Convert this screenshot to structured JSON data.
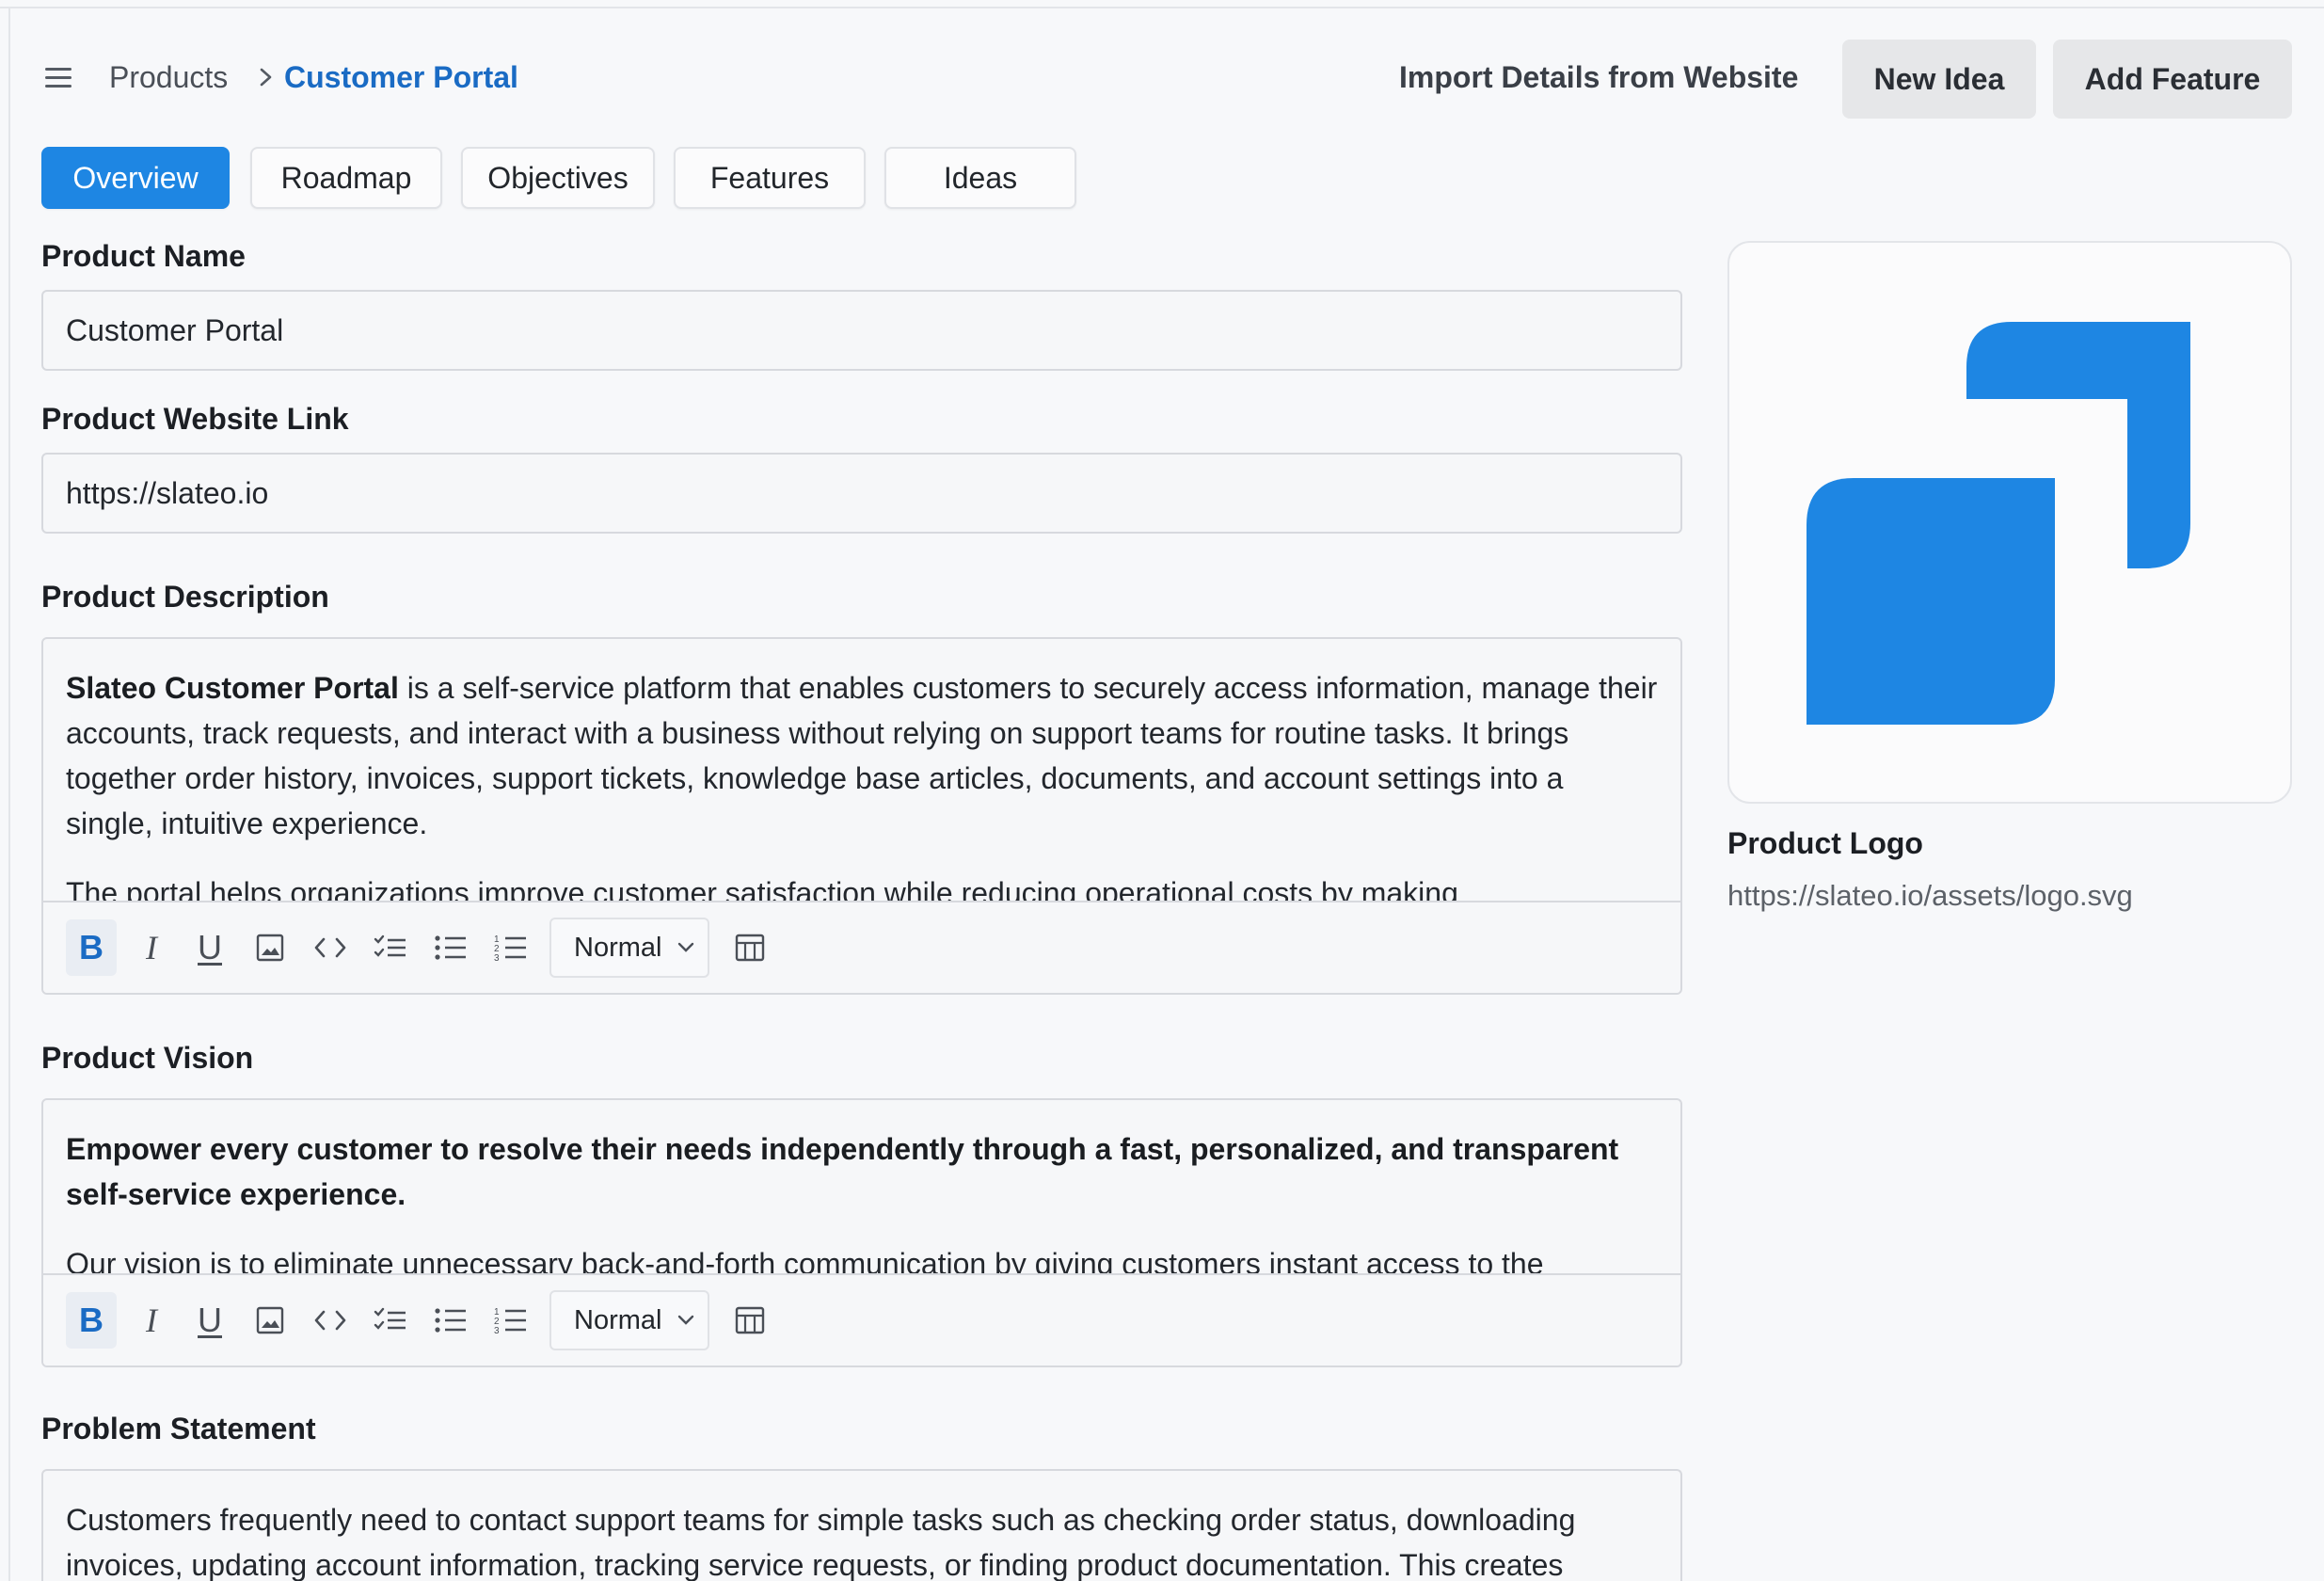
{
  "breadcrumb": {
    "parent": "Products",
    "current": "Customer Portal"
  },
  "header": {
    "import_label": "Import Details from Website",
    "new_idea_label": "New Idea",
    "add_feature_label": "Add Feature"
  },
  "tabs": [
    {
      "label": "Overview",
      "active": true
    },
    {
      "label": "Roadmap",
      "active": false
    },
    {
      "label": "Objectives",
      "active": false
    },
    {
      "label": "Features",
      "active": false
    },
    {
      "label": "Ideas",
      "active": false
    }
  ],
  "form": {
    "product_name": {
      "label": "Product Name",
      "value": "Customer Portal"
    },
    "website": {
      "label": "Product Website Link",
      "value": "https://slateo.io"
    },
    "description": {
      "label": "Product Description",
      "bold_lead": "Slateo Customer Portal",
      "para1_rest": " is a self-service platform that enables customers to securely access information, manage their accounts, track requests, and interact with a business without relying on support teams for routine tasks. It brings together order history, invoices, support tickets, knowledge base articles, documents, and account settings into a single, intuitive experience.",
      "para2": "The portal helps organizations improve customer satisfaction while reducing operational costs by making"
    },
    "vision": {
      "label": "Product Vision",
      "bold_para": "Empower every customer to resolve their needs independently through a fast, personalized, and transparent self-service experience.",
      "para2": "Our vision is to eliminate unnecessary back-and-forth communication by giving customers instant access to the"
    },
    "problem": {
      "label": "Problem Statement",
      "para1": "Customers frequently need to contact support teams for simple tasks such as checking order status, downloading invoices, updating account information, tracking service requests, or finding product documentation. This creates"
    }
  },
  "editor_toolbar": {
    "buttons": [
      "bold",
      "italic",
      "underline",
      "image",
      "code",
      "checklist",
      "bullet-list",
      "numbered-list",
      "table"
    ],
    "bold_glyph": "B",
    "italic_glyph": "I",
    "underline_glyph": "U",
    "block_style": "Normal"
  },
  "logo": {
    "title": "Product Logo",
    "url": "https://slateo.io/assets/logo.svg",
    "color": "#1e86e3"
  },
  "colors": {
    "accent": "#1e86e3",
    "link": "#1a6bc4"
  }
}
